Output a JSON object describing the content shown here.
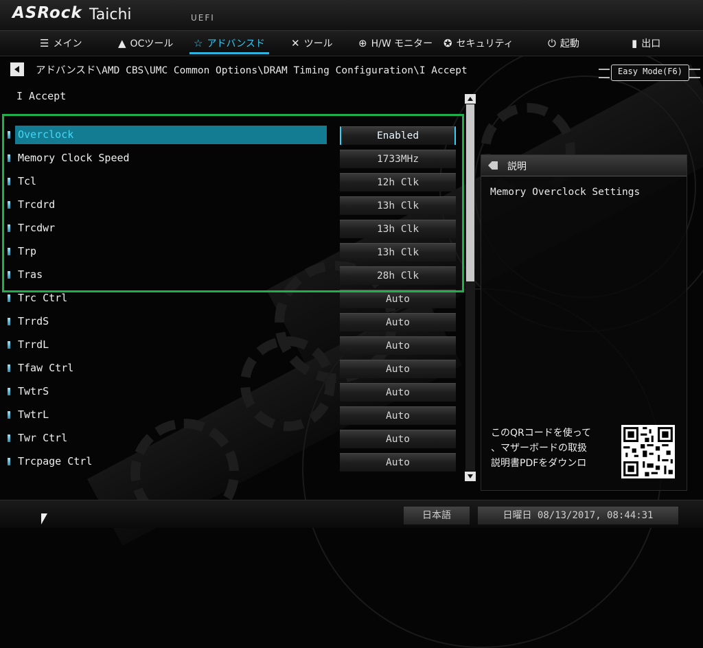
{
  "header": {
    "logo": "ASRock",
    "model": "Taichi",
    "firmware": "UEFI"
  },
  "tabs": [
    {
      "label": "メイン",
      "icon": "list-icon",
      "active": false
    },
    {
      "label": "OCツール",
      "icon": "rocket-icon",
      "active": false
    },
    {
      "label": "アドバンスド",
      "icon": "star-icon",
      "active": true
    },
    {
      "label": "ツール",
      "icon": "tools-icon",
      "active": false
    },
    {
      "label": "H/W モニター",
      "icon": "crosshair-icon",
      "active": false
    },
    {
      "label": "セキュリティ",
      "icon": "shield-icon",
      "active": false
    },
    {
      "label": "起動",
      "icon": "power-icon",
      "active": false
    },
    {
      "label": "出口",
      "icon": "exit-door-icon",
      "active": false
    }
  ],
  "breadcrumb": "アドバンスド\\AMD CBS\\UMC Common Options\\DRAM Timing Configuration\\I Accept",
  "easy_mode_label": "Easy Mode(F6)",
  "page_subtitle": "I Accept",
  "settings": [
    {
      "name": "Overclock",
      "value": "Enabled",
      "selected": true
    },
    {
      "name": "Memory Clock Speed",
      "value": "1733MHz"
    },
    {
      "name": "Tcl",
      "value": "12h Clk"
    },
    {
      "name": "Trcdrd",
      "value": "13h Clk"
    },
    {
      "name": "Trcdwr",
      "value": "13h Clk"
    },
    {
      "name": "Trp",
      "value": "13h Clk"
    },
    {
      "name": "Tras",
      "value": "28h Clk"
    },
    {
      "name": "Trc Ctrl",
      "value": "Auto"
    },
    {
      "name": "TrrdS",
      "value": "Auto"
    },
    {
      "name": "TrrdL",
      "value": "Auto"
    },
    {
      "name": "Tfaw Ctrl",
      "value": "Auto"
    },
    {
      "name": "TwtrS",
      "value": "Auto"
    },
    {
      "name": "TwtrL",
      "value": "Auto"
    },
    {
      "name": "Twr Ctrl",
      "value": "Auto"
    },
    {
      "name": "Trcpage Ctrl",
      "value": "Auto"
    }
  ],
  "help": {
    "title": "説明",
    "description": "Memory Overclock Settings",
    "qr_text": [
      "このQRコードを使って",
      "、マザーボードの取扱",
      "説明書PDFをダウンロ"
    ]
  },
  "footer": {
    "language": "日本語",
    "datetime": "日曜日 08/13/2017, 08:44:31"
  },
  "colors": {
    "accent": "#2fb4e0",
    "selected_row": "#137c92",
    "highlight_box": "#1fb04a"
  }
}
